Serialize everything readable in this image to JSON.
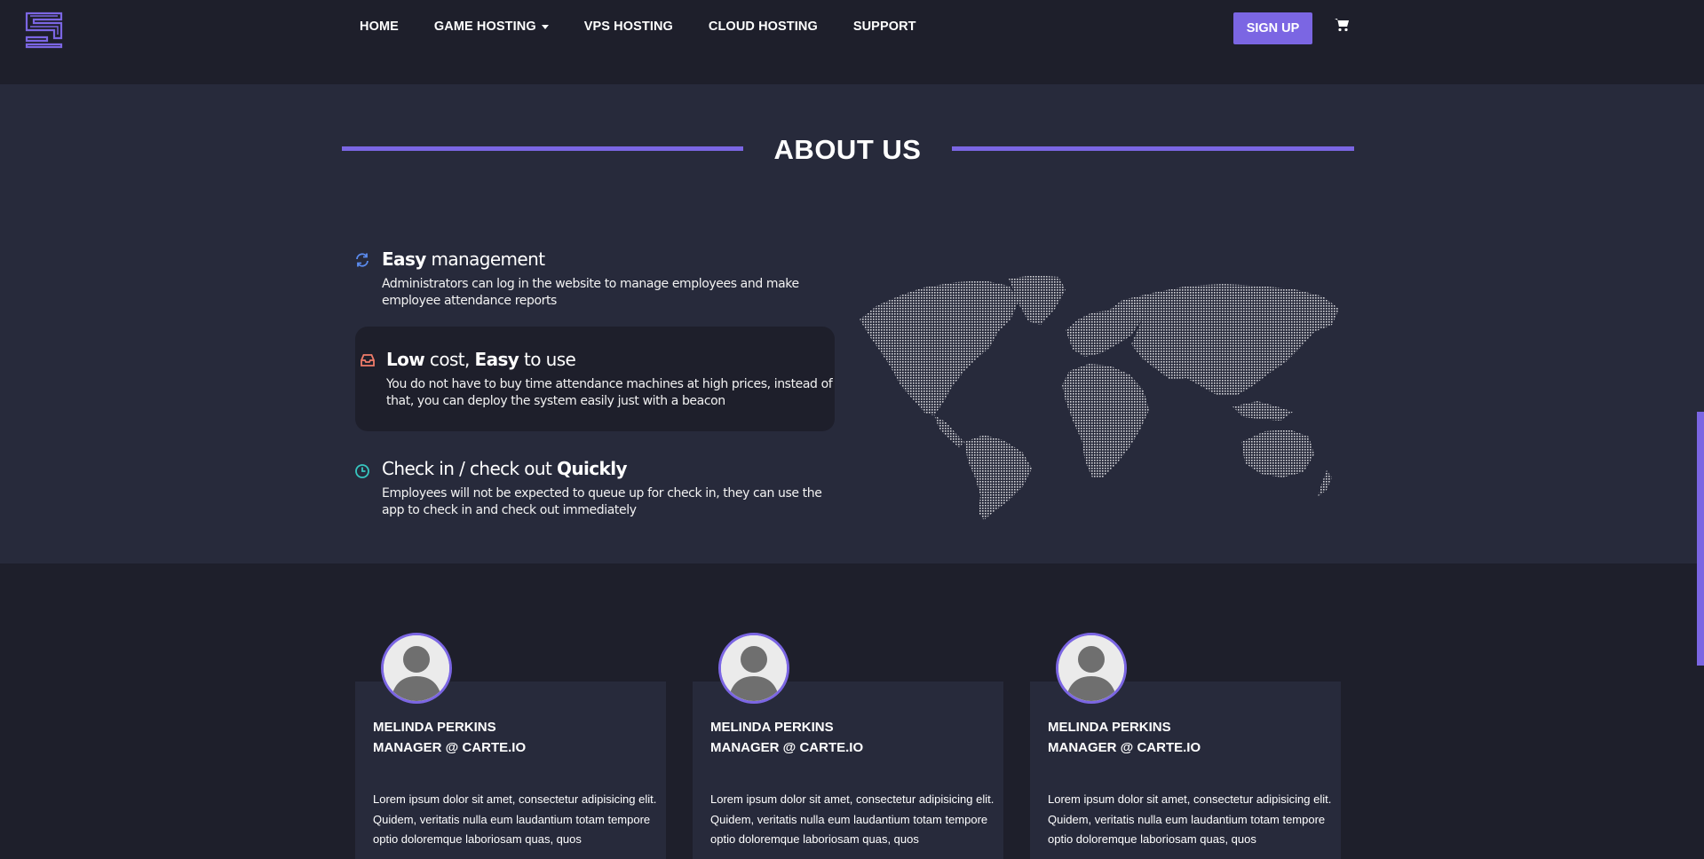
{
  "nav": {
    "links": [
      {
        "label": "HOME"
      },
      {
        "label": "GAME HOSTING",
        "has_dropdown": true
      },
      {
        "label": "VPS HOSTING"
      },
      {
        "label": "CLOUD HOSTING"
      },
      {
        "label": "SUPPORT"
      }
    ],
    "signup_label": "SIGN UP"
  },
  "about": {
    "title": "ABOUT US",
    "features": [
      {
        "title_parts": [
          {
            "text": "Easy",
            "bold": true
          },
          {
            "text": " management",
            "bold": false
          }
        ],
        "description": "Administrators can log in the website to manage employees and make employee attendance reports",
        "icon": "refresh-icon"
      },
      {
        "title_parts": [
          {
            "text": "Low",
            "bold": true
          },
          {
            "text": " cost, ",
            "bold": false
          },
          {
            "text": "Easy",
            "bold": true
          },
          {
            "text": " to use",
            "bold": false
          }
        ],
        "description": "You do not have to buy time attendance machines at high prices, instead of that, you can deploy the system easily just with a beacon",
        "icon": "inbox-icon"
      },
      {
        "title_parts": [
          {
            "text": "Check in / check out ",
            "bold": false
          },
          {
            "text": "Quickly",
            "bold": true
          }
        ],
        "description": "Employees will not be expected to queue up for check in, they can use the app to check in and check out immediately",
        "icon": "clock-icon"
      }
    ]
  },
  "team": {
    "members": [
      {
        "name": "MELINDA PERKINS",
        "role": "MANAGER @ CARTE.IO",
        "bio": "Lorem ipsum dolor sit amet, consectetur adipisicing elit. Quidem, veritatis nulla eum laudantium totam tempore optio doloremque laboriosam quas, quos"
      },
      {
        "name": "MELINDA PERKINS",
        "role": "MANAGER @ CARTE.IO",
        "bio": "Lorem ipsum dolor sit amet, consectetur adipisicing elit. Quidem, veritatis nulla eum laudantium totam tempore optio doloremque laboriosam quas, quos"
      },
      {
        "name": "MELINDA PERKINS",
        "role": "MANAGER @ CARTE.IO",
        "bio": "Lorem ipsum dolor sit amet, consectetur adipisicing elit. Quidem, veritatis nulla eum laudantium totam tempore optio doloremque laboriosam quas, quos"
      }
    ]
  },
  "colors": {
    "accent": "#7b66e3",
    "background": "#1e1f2b",
    "section_background": "#272a3b",
    "icon_refresh": "#5b8cf0",
    "icon_inbox": "#f07c6a",
    "icon_clock": "#37c6c0"
  }
}
